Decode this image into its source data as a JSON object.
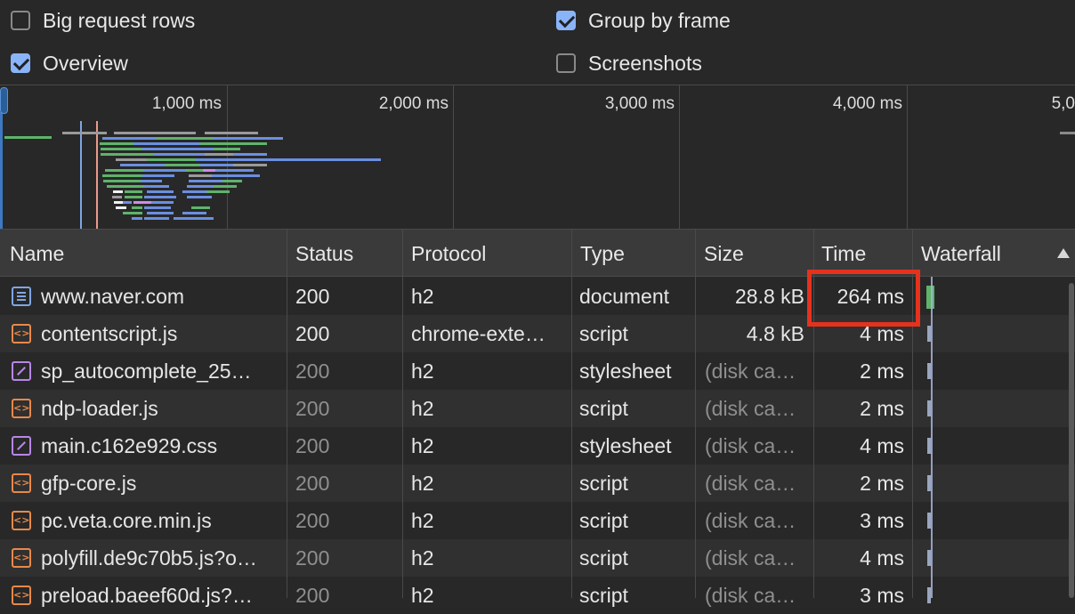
{
  "settings": {
    "big_request_rows": {
      "label": "Big request rows",
      "checked": false
    },
    "group_by_frame": {
      "label": "Group by frame",
      "checked": true
    },
    "overview": {
      "label": "Overview",
      "checked": true
    },
    "screenshots": {
      "label": "Screenshots",
      "checked": false
    }
  },
  "overview": {
    "ticks": [
      "1,000 ms",
      "2,000 ms",
      "3,000 ms",
      "4,000 ms",
      "5,0"
    ]
  },
  "table": {
    "columns": [
      "Name",
      "Status",
      "Protocol",
      "Type",
      "Size",
      "Time",
      "Waterfall"
    ],
    "rows": [
      {
        "icon": "document-icon",
        "name": "www.naver.com",
        "status": "200",
        "protocol": "h2",
        "type": "document",
        "size": "28.8 kB",
        "time": "264 ms",
        "dim": false
      },
      {
        "icon": "script-icon",
        "name": "contentscript.js",
        "status": "200",
        "protocol": "chrome-exte…",
        "type": "script",
        "size": "4.8 kB",
        "time": "4 ms",
        "dim": false
      },
      {
        "icon": "stylesheet-icon",
        "name": "sp_autocomplete_25…",
        "status": "200",
        "protocol": "h2",
        "type": "stylesheet",
        "size": "(disk ca…",
        "time": "2 ms",
        "dim": true
      },
      {
        "icon": "script-icon",
        "name": "ndp-loader.js",
        "status": "200",
        "protocol": "h2",
        "type": "script",
        "size": "(disk ca…",
        "time": "2 ms",
        "dim": true
      },
      {
        "icon": "stylesheet-icon",
        "name": "main.c162e929.css",
        "status": "200",
        "protocol": "h2",
        "type": "stylesheet",
        "size": "(disk ca…",
        "time": "4 ms",
        "dim": true
      },
      {
        "icon": "script-icon",
        "name": "gfp-core.js",
        "status": "200",
        "protocol": "h2",
        "type": "script",
        "size": "(disk ca…",
        "time": "2 ms",
        "dim": true
      },
      {
        "icon": "script-icon",
        "name": "pc.veta.core.min.js",
        "status": "200",
        "protocol": "h2",
        "type": "script",
        "size": "(disk ca…",
        "time": "3 ms",
        "dim": true
      },
      {
        "icon": "script-icon",
        "name": "polyfill.de9c70b5.js?o…",
        "status": "200",
        "protocol": "h2",
        "type": "script",
        "size": "(disk ca…",
        "time": "4 ms",
        "dim": true
      },
      {
        "icon": "script-icon",
        "name": "preload.baeef60d.js?…",
        "status": "200",
        "protocol": "h2",
        "type": "script",
        "size": "(disk ca…",
        "time": "3 ms",
        "dim": true
      }
    ]
  },
  "colors": {
    "highlight": "#e5321d",
    "accent": "#8ab4f8",
    "bar_green": "#5fb36a",
    "bar_blue": "#6b8fe0"
  }
}
